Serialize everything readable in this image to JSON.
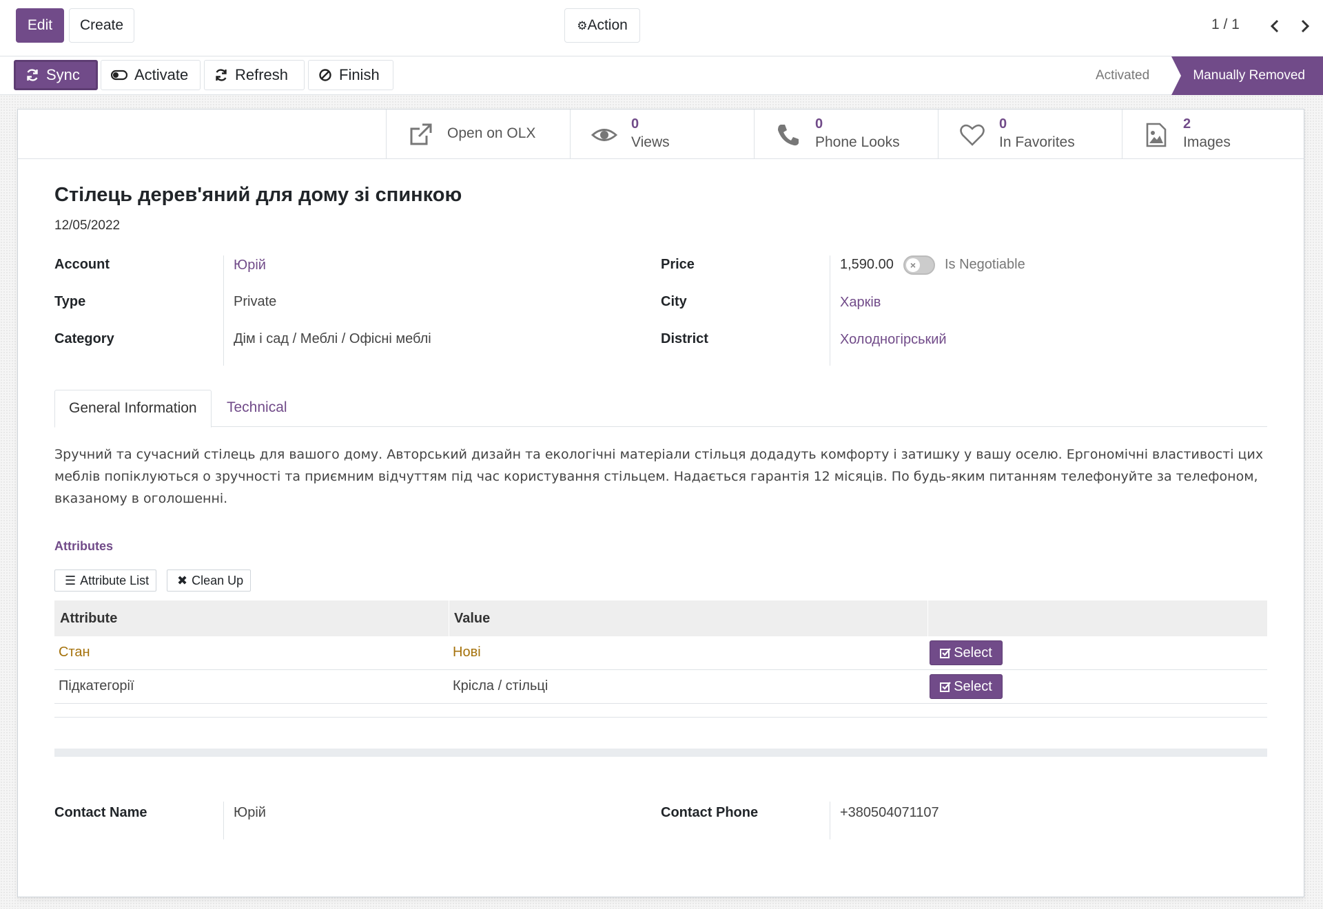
{
  "control_panel": {
    "edit_label": "Edit",
    "create_label": "Create",
    "action_label": "Action",
    "pager": "1 / 1"
  },
  "status_buttons": {
    "sync": "Sync",
    "activate": "Activate",
    "refresh": "Refresh",
    "finish": "Finish"
  },
  "stages": {
    "previous": "Activated",
    "current": "Manually Removed"
  },
  "smart_buttons": {
    "open": "Open on OLX",
    "views": {
      "value": "0",
      "label": "Views"
    },
    "phone": {
      "value": "0",
      "label": "Phone Looks"
    },
    "favorites": {
      "value": "0",
      "label": "In Favorites"
    },
    "images": {
      "value": "2",
      "label": "Images"
    }
  },
  "record": {
    "title": "Стілець дерев'яний для дому зі спинкою",
    "date": "12/05/2022"
  },
  "fields": {
    "account": {
      "label": "Account",
      "value": "Юрій"
    },
    "type": {
      "label": "Type",
      "value": "Private"
    },
    "category": {
      "label": "Category",
      "value": "Дім і сад / Меблі / Офісні меблі"
    },
    "price": {
      "label": "Price",
      "value": "1,590.00",
      "negotiable_label": "Is Negotiable",
      "negotiable": false
    },
    "city": {
      "label": "City",
      "value": "Харків"
    },
    "district": {
      "label": "District",
      "value": "Холодногірський"
    }
  },
  "tabs": {
    "general": "General Information",
    "technical": "Technical"
  },
  "description": "Зручний та сучасний стілець для вашого дому. Авторський дизайн та екологічні матеріали стільця додадуть комфорту і затишку у вашу оселю. Ергономічні властивості цих меблів попіклуються о зручності та приємним відчуттям під час користування стільцем. Надається гарантія 12 місяців. По будь-яким питанням телефонуйте за телефоном, вказаному в оголошенні.",
  "attributes": {
    "heading": "Attributes",
    "list_btn": "Attribute List",
    "cleanup_btn": "Clean Up",
    "columns": [
      "Attribute",
      "Value"
    ],
    "select_label": "Select",
    "rows": [
      {
        "attribute": "Стан",
        "value": "Нові"
      },
      {
        "attribute": "Підкатегорії",
        "value": "Крісла / стільці"
      }
    ]
  },
  "contact": {
    "name_label": "Contact Name",
    "name_value": "Юрій",
    "phone_label": "Contact Phone",
    "phone_value": "+380504071107"
  },
  "colors": {
    "brand": "#714b89",
    "warning_text": "#a5720c"
  }
}
